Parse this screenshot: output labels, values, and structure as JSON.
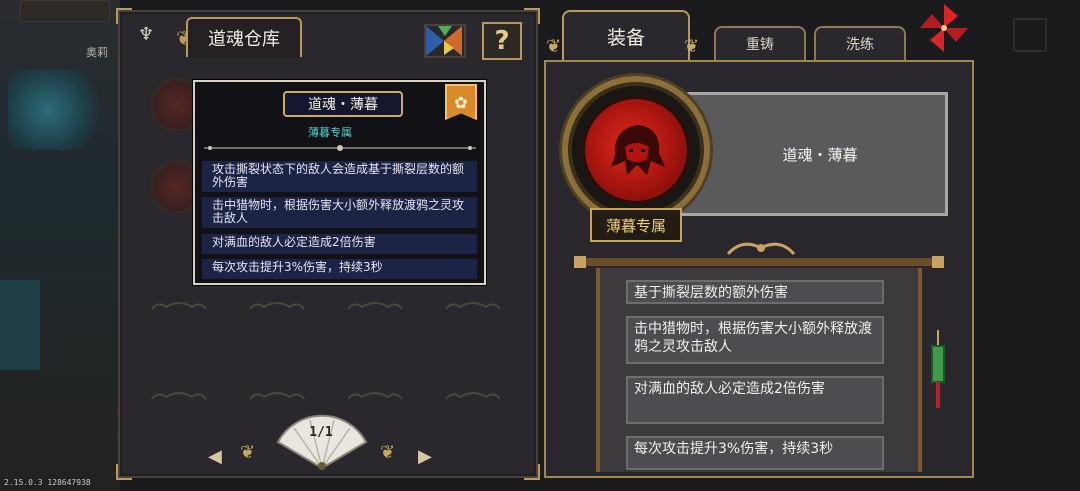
{
  "app": {
    "version": "2.15.0.3 128647938"
  },
  "background": {
    "top_name": "奥莉"
  },
  "storage": {
    "title": "道魂仓库",
    "help_label": "?",
    "page_indicator": "1/1",
    "prev_label": "◀",
    "next_label": "▶"
  },
  "tooltip": {
    "title": "道魂・薄暮",
    "subtitle": "薄暮专属",
    "badge": "✿",
    "effects": [
      "攻击撕裂状态下的敌人会造成基于撕裂层数的额外伤害",
      "击中猎物时，根据伤害大小额外释放渡鸦之灵攻击敌人",
      "对满血的敌人必定造成2倍伤害",
      "每次攻击提升3%伤害，持续3秒"
    ]
  },
  "tabs": {
    "equip": "装备",
    "reforge": "重铸",
    "refine": "洗练"
  },
  "equipment": {
    "name": "道魂・薄暮",
    "exclusive_label": "薄暮专属",
    "effects": [
      "基于撕裂层数的额外伤害",
      "击中猎物时，根据伤害大小额外释放渡鸦之灵攻击敌人",
      "对满血的敌人必定造成2倍伤害",
      "每次攻击提升3%伤害，持续3秒"
    ]
  },
  "colors": {
    "accent_gold": "#b89a5e",
    "tooltip_row": "#1c2446",
    "medallion_red": "#e02b1a",
    "subtitle_cyan": "#41d8d0"
  },
  "icons": {
    "tangram": "tangram-icon",
    "help": "help-icon",
    "pinwheel": "pinwheel-icon",
    "fan": "fan-icon"
  }
}
